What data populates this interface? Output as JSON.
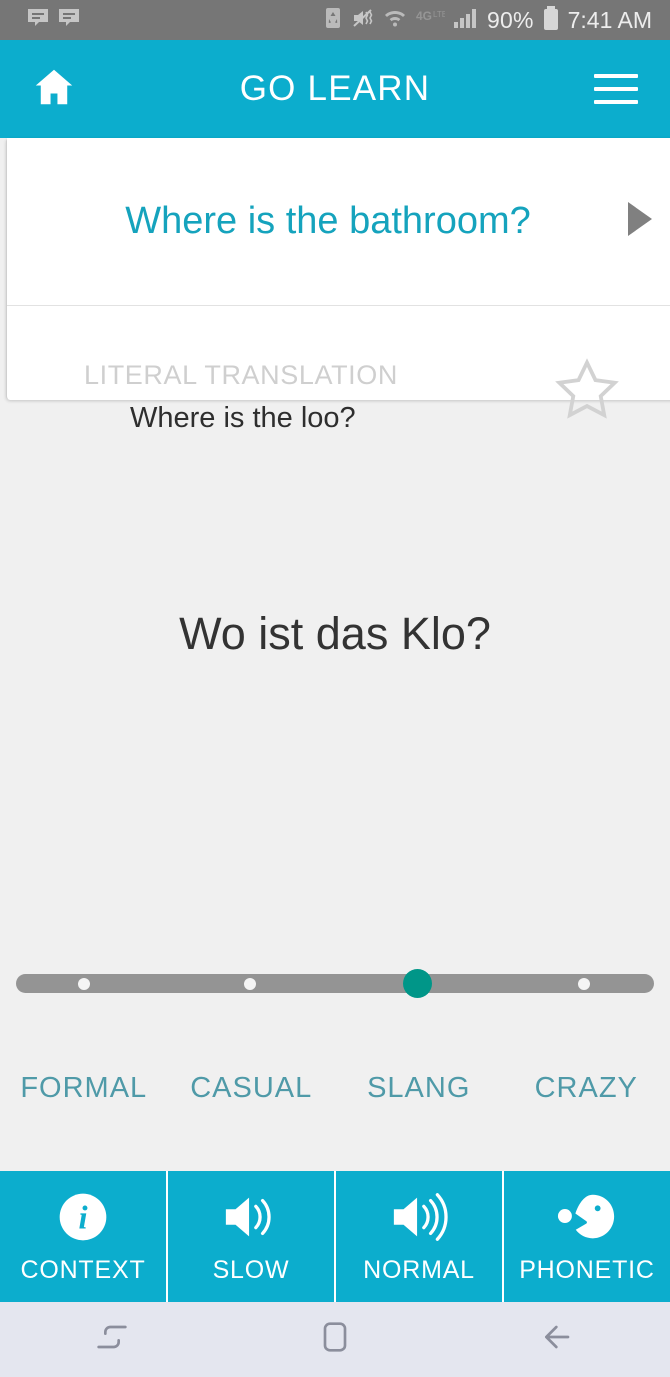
{
  "statusbar": {
    "notification_icons": [
      "message-icon",
      "message-icon"
    ],
    "system_icons": [
      "recycle-icon",
      "mute-vibrate-icon",
      "wifi-icon",
      "4g-lte-icon",
      "signal-bars-icon"
    ],
    "battery_percent": "90%",
    "battery_icon": "battery-icon",
    "time": "7:41 AM"
  },
  "header": {
    "title": "GO LEARN",
    "home_icon": "home-icon",
    "menu_icon": "hamburger-menu-icon",
    "background": "#0cadcd"
  },
  "card": {
    "phrase": "Where is the bathroom?",
    "next_icon": "play-triangle-icon",
    "phrase_color": "#15a3bd"
  },
  "literal": {
    "label": "LITERAL TRANSLATION",
    "text": "Where is the loo?",
    "star_icon": "star-outline-icon",
    "starred": "false"
  },
  "translation": {
    "text": "Wo ist das Klo?"
  },
  "slider": {
    "selected_index": "2",
    "accent": "#009688",
    "track_color": "#949494",
    "positions": [
      "84",
      "250",
      "417",
      "584"
    ]
  },
  "registers": [
    {
      "label": "FORMAL"
    },
    {
      "label": "CASUAL"
    },
    {
      "label": "SLANG"
    },
    {
      "label": "CRAZY"
    }
  ],
  "actions": [
    {
      "label": "CONTEXT",
      "icon": "info-circle-icon"
    },
    {
      "label": "SLOW",
      "icon": "speaker-low-volume-icon"
    },
    {
      "label": "NORMAL",
      "icon": "speaker-high-volume-icon"
    },
    {
      "label": "PHONETIC",
      "icon": "speaking-head-icon"
    }
  ],
  "navbar": {
    "recents_icon": "recents-icon",
    "home_icon": "home-square-icon",
    "back_icon": "back-arrow-icon"
  }
}
